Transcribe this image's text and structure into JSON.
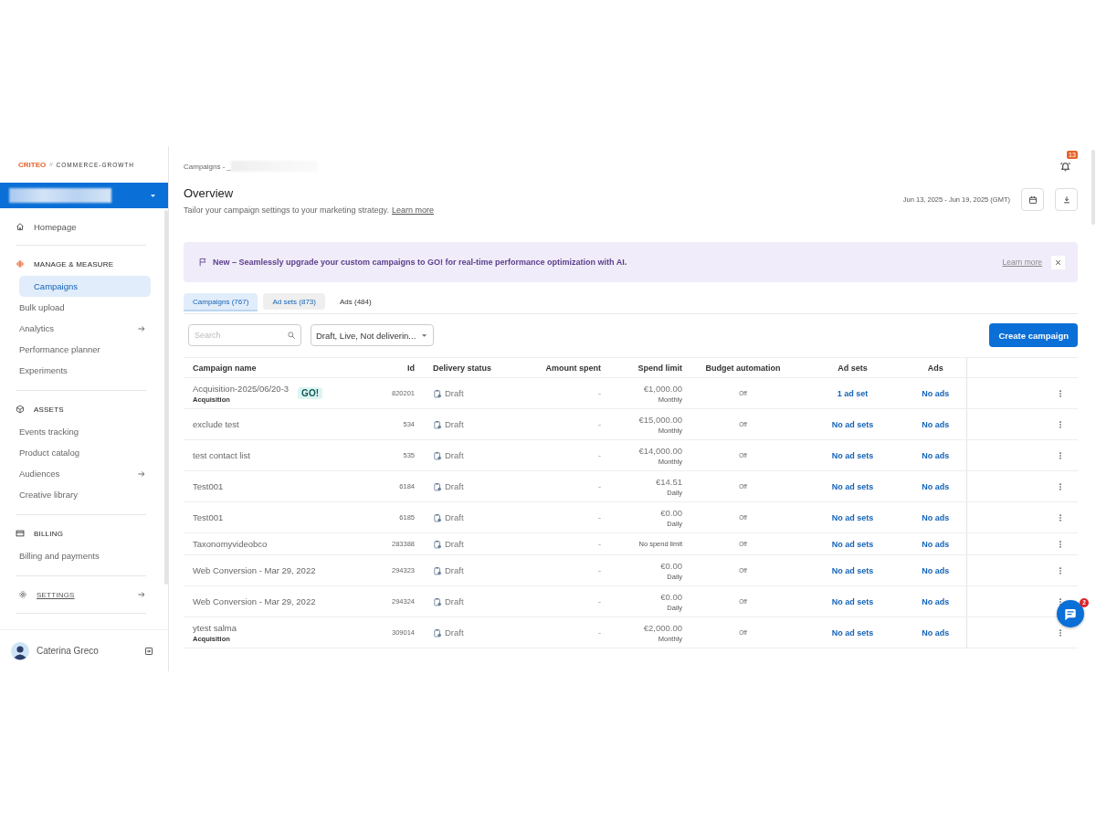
{
  "sidebar": {
    "logo": {
      "brand": "CRITEO",
      "separator": "//",
      "product": "COMMERCE-GROWTH"
    },
    "home": {
      "label": "Homepage",
      "selected": false
    },
    "sections": [
      {
        "title": "MANAGE & MEASURE",
        "submenu": false,
        "items": [
          {
            "label": "Campaigns",
            "selected": true,
            "submenu": false
          },
          {
            "label": "Bulk upload",
            "selected": false,
            "submenu": false
          },
          {
            "label": "Analytics",
            "selected": false,
            "submenu": true
          },
          {
            "label": "Performance planner",
            "selected": false,
            "submenu": false
          },
          {
            "label": "Experiments",
            "selected": false,
            "submenu": false
          }
        ]
      },
      {
        "title": "ASSETS",
        "submenu": false,
        "items": [
          {
            "label": "Events tracking",
            "selected": false,
            "submenu": false
          },
          {
            "label": "Product catalog",
            "selected": false,
            "submenu": false
          },
          {
            "label": "Audiences",
            "selected": false,
            "submenu": true
          },
          {
            "label": "Creative library",
            "selected": false,
            "submenu": false
          }
        ]
      },
      {
        "title": "BILLING",
        "submenu": false,
        "items": [
          {
            "label": "Billing and payments",
            "selected": false,
            "submenu": false
          }
        ]
      },
      {
        "title": "SETTINGS",
        "submenu": true
      }
    ],
    "user": {
      "name": "Caterina Greco"
    }
  },
  "header": {
    "breadcrumb": "Campaigns - _",
    "notifications": "13",
    "title": "Overview",
    "subtitle": "Tailor your campaign settings to your marketing strategy.",
    "subtitle_link": "Learn more",
    "date_range": "Jun 13, 2025 - Jun 19, 2025 (GMT)"
  },
  "banner": {
    "text": "New – Seamlessly upgrade your custom campaigns to GO! for real-time performance optimization with AI.",
    "link": "Learn more"
  },
  "tabs": [
    {
      "label": "Campaigns (767)",
      "selected": true,
      "hovered": false
    },
    {
      "label": "Ad sets (873)",
      "selected": false,
      "hovered": true
    },
    {
      "label": "Ads (484)",
      "selected": false,
      "hovered": false
    }
  ],
  "toolbar": {
    "search": {
      "placeholder": "Search"
    },
    "filter": "Draft, Live, Not deliverin...",
    "create_button": "Create campaign"
  },
  "table": {
    "columns": [
      "Campaign name",
      "Id",
      "Delivery status",
      "Amount spent",
      "Spend limit",
      "Budget automation",
      "Ad sets",
      "Ads"
    ],
    "rows": [
      {
        "name": "Acquisition-2025/06/20-3",
        "subtitle": "Acquisition",
        "badge": "GO!",
        "id": "820201",
        "status": {
          "label": "Draft",
          "kind": "draft"
        },
        "amount_spent": "-",
        "spend_limit": "€1,000.00",
        "period": "Monthly",
        "budget_automation": "Off",
        "ad_sets": "1 ad set",
        "ads": "No ads"
      },
      {
        "name": "exclude test",
        "id": "534",
        "status": {
          "label": "Draft",
          "kind": "draft"
        },
        "amount_spent": "-",
        "spend_limit": "€15,000.00",
        "period": "Monthly",
        "budget_automation": "Off",
        "ad_sets": "No ad sets",
        "ads": "No ads"
      },
      {
        "name": "test contact list",
        "id": "535",
        "status": {
          "label": "Draft",
          "kind": "draft"
        },
        "amount_spent": "-",
        "spend_limit": "€14,000.00",
        "period": "Monthly",
        "budget_automation": "Off",
        "ad_sets": "No ad sets",
        "ads": "No ads"
      },
      {
        "name": "Test001",
        "id": "6184",
        "status": {
          "label": "Draft",
          "kind": "draft"
        },
        "amount_spent": "-",
        "spend_limit": "€14.51",
        "period": "Daily",
        "budget_automation": "Off",
        "ad_sets": "No ad sets",
        "ads": "No ads"
      },
      {
        "name": "Test001",
        "id": "6185",
        "status": {
          "label": "Draft",
          "kind": "draft"
        },
        "amount_spent": "-",
        "spend_limit": "€0.00",
        "period": "Daily",
        "budget_automation": "Off",
        "ad_sets": "No ad sets",
        "ads": "No ads"
      },
      {
        "name": "Taxonomyvideobco",
        "id": "283388",
        "status": {
          "label": "Draft",
          "kind": "draft"
        },
        "amount_spent": "-",
        "spend_limit": "No spend limit",
        "budget_automation": "Off",
        "ad_sets": "No ad sets",
        "ads": "No ads"
      },
      {
        "name": "Web Conversion - Mar 29, 2022",
        "id": "294323",
        "status": {
          "label": "Draft",
          "kind": "draft"
        },
        "amount_spent": "-",
        "spend_limit": "€0.00",
        "period": "Daily",
        "budget_automation": "Off",
        "ad_sets": "No ad sets",
        "ads": "No ads"
      },
      {
        "name": "Web Conversion - Mar 29, 2022",
        "id": "294324",
        "status": {
          "label": "Draft",
          "kind": "draft"
        },
        "amount_spent": "-",
        "spend_limit": "€0.00",
        "period": "Daily",
        "budget_automation": "Off",
        "ad_sets": "No ad sets",
        "ads": "No ads"
      },
      {
        "name": "ytest salma",
        "subtitle": "Acquisition",
        "id": "309014",
        "status": {
          "label": "Draft",
          "kind": "draft"
        },
        "amount_spent": "-",
        "spend_limit": "€2,000.00",
        "period": "Monthly",
        "budget_automation": "Off",
        "ad_sets": "No ad sets",
        "ads": "No ads"
      }
    ]
  },
  "chat": {
    "badge": "2"
  }
}
